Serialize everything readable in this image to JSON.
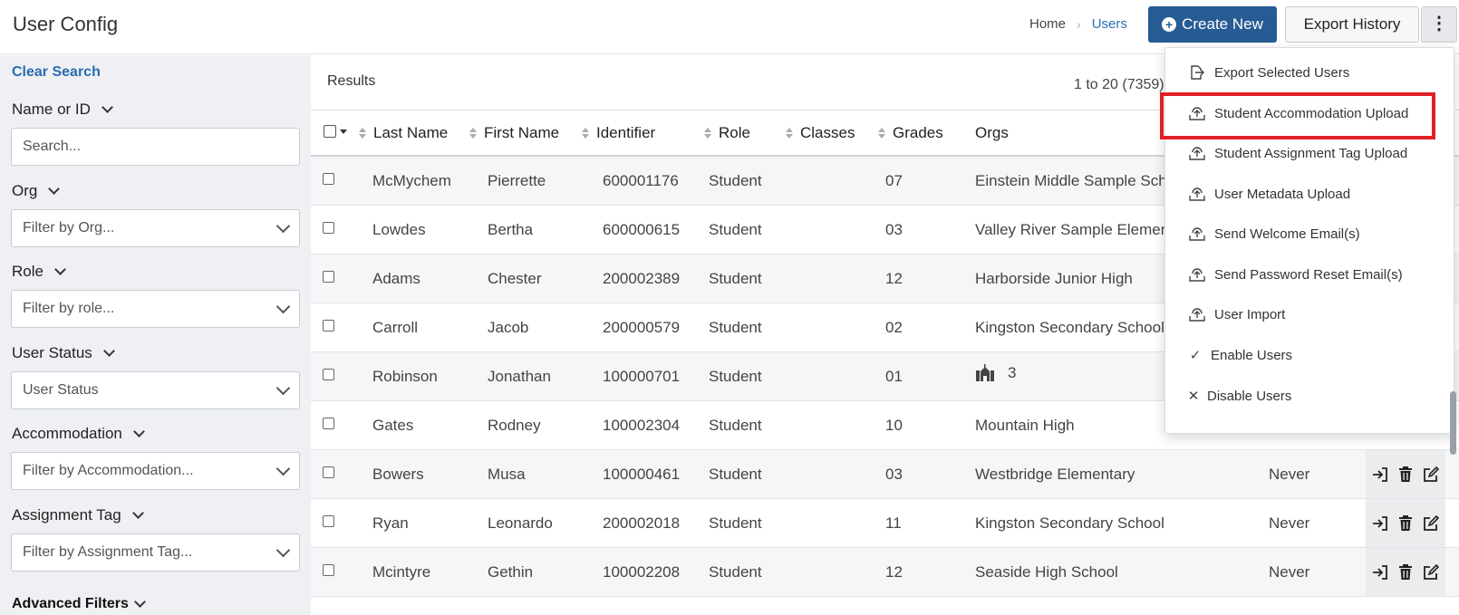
{
  "header": {
    "title": "User Config",
    "breadcrumb": {
      "home": "Home",
      "separator": "›",
      "current": "Users"
    },
    "create_new_label": "Create New",
    "export_history_label": "Export History",
    "kebab_label": "⋮"
  },
  "sidebar": {
    "clear_search": "Clear Search",
    "filters": [
      {
        "label": "Name or ID",
        "placeholder": "Search..."
      },
      {
        "label": "Org",
        "placeholder": "Filter by Org..."
      },
      {
        "label": "Role",
        "placeholder": "Filter by role..."
      },
      {
        "label": "User Status",
        "placeholder": "User Status"
      },
      {
        "label": "Accommodation",
        "placeholder": "Filter by Accommodation..."
      },
      {
        "label": "Assignment Tag",
        "placeholder": "Filter by Assignment Tag..."
      }
    ],
    "advanced_filters": "Advanced Filters"
  },
  "results": {
    "title": "Results",
    "pager": "1 to 20 (7359)",
    "columns": [
      "Last Name",
      "First Name",
      "Identifier",
      "Role",
      "Classes",
      "Grades",
      "Orgs"
    ],
    "rows": [
      {
        "last": "McMychem",
        "first": "Pierrette",
        "id": "600001176",
        "role": "Student",
        "grade": "07",
        "org": "Einstein Middle Sample Sch",
        "last_login": ""
      },
      {
        "last": "Lowdes",
        "first": "Bertha",
        "id": "600000615",
        "role": "Student",
        "grade": "03",
        "org": "Valley River Sample Elemen",
        "last_login": ""
      },
      {
        "last": "Adams",
        "first": "Chester",
        "id": "200002389",
        "role": "Student",
        "grade": "12",
        "org": "Harborside Junior High",
        "last_login": ""
      },
      {
        "last": "Carroll",
        "first": "Jacob",
        "id": "200000579",
        "role": "Student",
        "grade": "02",
        "org": "Kingston Secondary School",
        "last_login": ""
      },
      {
        "last": "Robinson",
        "first": "Jonathan",
        "id": "100000701",
        "role": "Student",
        "grade": "01",
        "org": "3",
        "last_login": ""
      },
      {
        "last": "Gates",
        "first": "Rodney",
        "id": "100002304",
        "role": "Student",
        "grade": "10",
        "org": "Mountain High",
        "last_login": ""
      },
      {
        "last": "Bowers",
        "first": "Musa",
        "id": "100000461",
        "role": "Student",
        "grade": "03",
        "org": "Westbridge Elementary",
        "last_login": "Never"
      },
      {
        "last": "Ryan",
        "first": "Leonardo",
        "id": "200002018",
        "role": "Student",
        "grade": "11",
        "org": "Kingston Secondary School",
        "last_login": "Never"
      },
      {
        "last": "Mcintyre",
        "first": "Gethin",
        "id": "100002208",
        "role": "Student",
        "grade": "12",
        "org": "Seaside High School",
        "last_login": "Never"
      }
    ]
  },
  "menu": {
    "items": [
      {
        "label": "Export Selected Users",
        "icon": "export-icon"
      },
      {
        "label": "Student Accommodation Upload",
        "icon": "upload-cloud-icon"
      },
      {
        "label": "Student Assignment Tag Upload",
        "icon": "upload-cloud-icon"
      },
      {
        "label": "User Metadata Upload",
        "icon": "upload-cloud-icon"
      },
      {
        "label": "Send Welcome Email(s)",
        "icon": "upload-cloud-icon"
      },
      {
        "label": "Send Password Reset Email(s)",
        "icon": "upload-cloud-icon"
      },
      {
        "label": "User Import",
        "icon": "upload-cloud-icon"
      },
      {
        "label": "Enable Users",
        "icon": "check-icon"
      },
      {
        "label": "Disable Users",
        "icon": "x-icon"
      }
    ]
  },
  "colors": {
    "primary": "#265b93",
    "link": "#2a6cb0",
    "highlight": "#e01f26",
    "sidebar_bg": "#eef0f3"
  }
}
